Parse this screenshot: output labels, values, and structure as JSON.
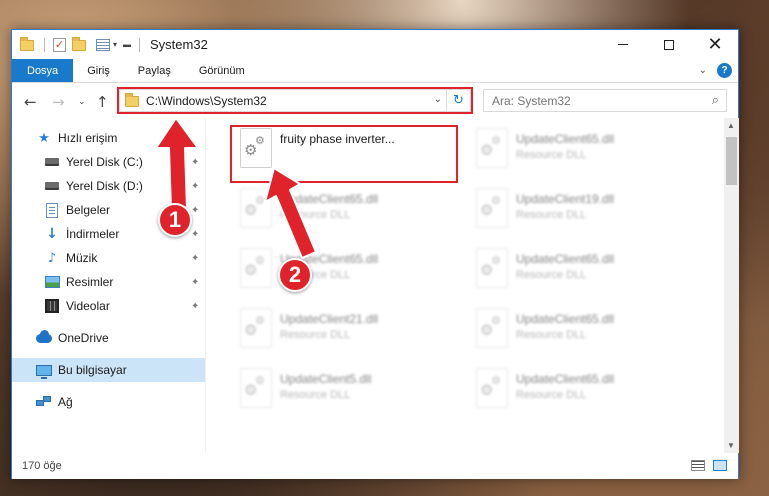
{
  "titlebar": {
    "title": "System32",
    "dropdown_glyph": "▾"
  },
  "ribbon": {
    "tabs": [
      "Dosya",
      "Giriş",
      "Paylaş",
      "Görünüm"
    ],
    "help_label": "?"
  },
  "address": {
    "path": "C:\\Windows\\System32",
    "search_placeholder": "Ara: System32"
  },
  "nav_pane": {
    "items": [
      {
        "label": "Hızlı erişim",
        "icon": "star-icon",
        "pinned": false
      },
      {
        "label": "Yerel Disk (C:)",
        "icon": "drive-icon",
        "pinned": true
      },
      {
        "label": "Yerel Disk (D:)",
        "icon": "drive-icon",
        "pinned": true
      },
      {
        "label": "Belgeler",
        "icon": "documents-icon",
        "pinned": true
      },
      {
        "label": "İndirmeler",
        "icon": "download-icon",
        "pinned": true
      },
      {
        "label": "Müzik",
        "icon": "music-icon",
        "pinned": true
      },
      {
        "label": "Resimler",
        "icon": "pictures-icon",
        "pinned": true
      },
      {
        "label": "Videolar",
        "icon": "videos-icon",
        "pinned": true
      },
      {
        "label": "OneDrive",
        "icon": "onedrive-icon",
        "pinned": false
      },
      {
        "label": "Bu bilgisayar",
        "icon": "this-pc-icon",
        "pinned": false,
        "selected": true
      },
      {
        "label": "Ağ",
        "icon": "network-icon",
        "pinned": false
      }
    ]
  },
  "files": [
    {
      "name": "fruity phase inverter...",
      "desc": "",
      "highlighted": true
    },
    {
      "name": "UpdateClient65.dll",
      "desc": "Resource DLL"
    },
    {
      "name": "UpdateClient65.dll",
      "desc": "Resource DLL"
    },
    {
      "name": "UpdateClient19.dll",
      "desc": "Resource DLL"
    },
    {
      "name": "UpdateClient65.dll",
      "desc": "Resource DLL"
    },
    {
      "name": "UpdateClient65.dll",
      "desc": "Resource DLL"
    },
    {
      "name": "UpdateClient21.dll",
      "desc": "Resource DLL"
    },
    {
      "name": "UpdateClient65.dll",
      "desc": "Resource DLL"
    },
    {
      "name": "UpdateClient5.dll",
      "desc": "Resource DLL"
    },
    {
      "name": "UpdateClient65.dll",
      "desc": "Resource DLL"
    }
  ],
  "status": {
    "item_count": "170 öğe"
  },
  "annotations": {
    "callout_1": "1",
    "callout_2": "2",
    "highlight_color": "#e0222a"
  },
  "colors": {
    "accent": "#1979ca",
    "selection": "#cce4f7"
  }
}
